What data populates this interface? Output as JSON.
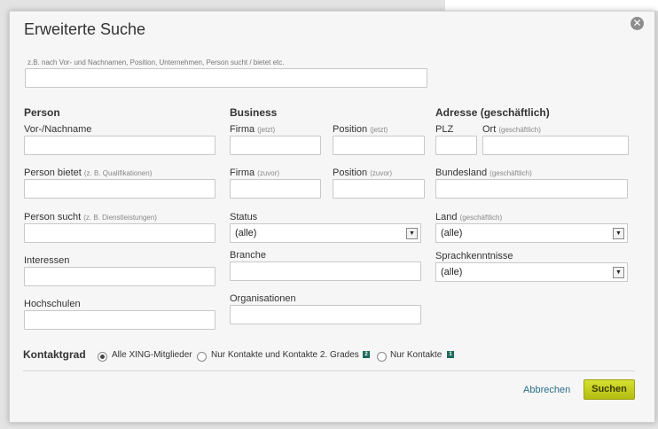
{
  "dialog": {
    "title": "Erweiterte Suche",
    "close_icon": "close-icon"
  },
  "keyword": {
    "hint": "z.B. nach Vor- und Nachnamen, Position, Unternehmen, Person sucht / bietet etc.",
    "value": ""
  },
  "person": {
    "heading": "Person",
    "name_label": "Vor-/Nachname",
    "offers_label": "Person bietet",
    "offers_hint": "(z. B. Qualifikationen)",
    "seeks_label": "Person sucht",
    "seeks_hint": "(z. B. Dienstleistungen)",
    "interests_label": "Interessen",
    "universities_label": "Hochschulen"
  },
  "business": {
    "heading": "Business",
    "company_current_label": "Firma",
    "company_current_hint": "(jetzt)",
    "position_current_label": "Position",
    "position_current_hint": "(jetzt)",
    "company_previous_label": "Firma",
    "company_previous_hint": "(zuvor)",
    "position_previous_label": "Position",
    "position_previous_hint": "(zuvor)",
    "status_label": "Status",
    "status_value": "(alle)",
    "industry_label": "Branche",
    "organizations_label": "Organisationen"
  },
  "address": {
    "heading": "Adresse (geschäftlich)",
    "zip_label": "PLZ",
    "city_label": "Ort",
    "city_hint": "(geschäftlich)",
    "state_label": "Bundesland",
    "state_hint": "(geschäftlich)",
    "country_label": "Land",
    "country_hint": "(geschäftlich)",
    "country_value": "(alle)",
    "languages_label": "Sprachkenntnisse",
    "languages_value": "(alle)"
  },
  "contact_degree": {
    "heading": "Kontaktgrad",
    "options": [
      {
        "label": "Alle XING-Mitglieder",
        "checked": true
      },
      {
        "label": "Nur Kontakte und Kontakte 2. Grades",
        "badge": "2"
      },
      {
        "label": "Nur Kontakte",
        "badge": "1"
      }
    ]
  },
  "footer": {
    "cancel_label": "Abbrechen",
    "search_label": "Suchen"
  },
  "colors": {
    "search_button": "#c4cc1a",
    "link": "#2b6f8a",
    "badge": "#1e6b5b"
  }
}
